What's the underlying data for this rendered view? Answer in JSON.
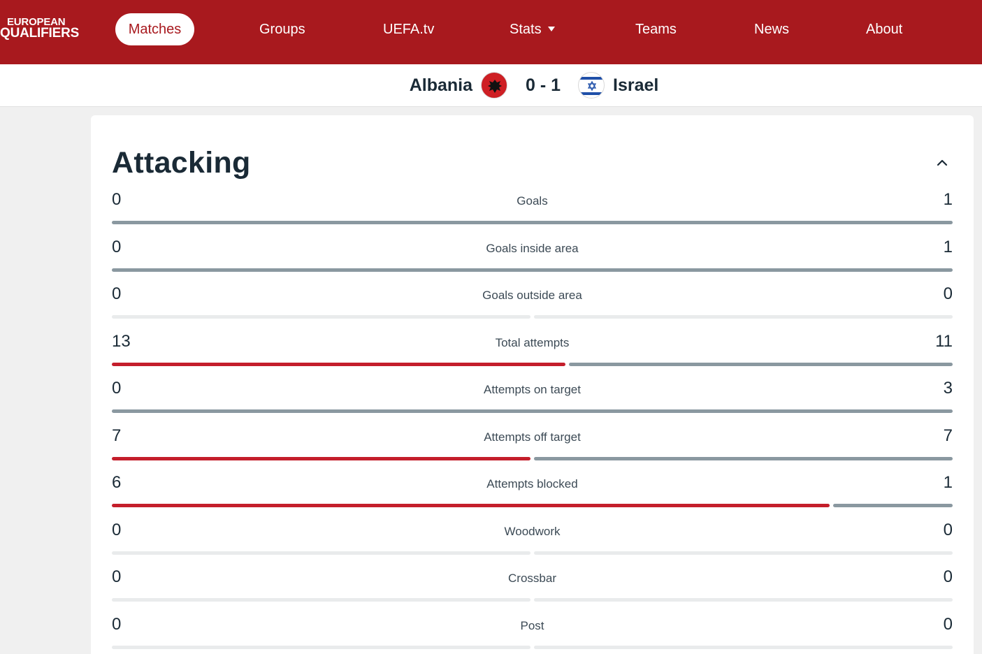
{
  "nav": {
    "logo_line1": "EUROPEAN",
    "logo_line2": "QUALIFIERS",
    "items": [
      {
        "label": "Matches",
        "active": true
      },
      {
        "label": "Groups"
      },
      {
        "label": "UEFA.tv"
      },
      {
        "label": "Stats",
        "has_dropdown": true
      },
      {
        "label": "Teams"
      },
      {
        "label": "News"
      },
      {
        "label": "About"
      }
    ]
  },
  "match": {
    "home_team": "Albania",
    "away_team": "Israel",
    "score": "0 - 1"
  },
  "section": {
    "title": "Attacking",
    "expanded": true
  },
  "colors": {
    "brand": "#a8191e",
    "home_bar": "#c41e2b",
    "away_bar": "#8a98a0",
    "empty_bar": "#e9ebec"
  },
  "stats": [
    {
      "label": "Goals",
      "home": "0",
      "away": "1"
    },
    {
      "label": "Goals inside area",
      "home": "0",
      "away": "1"
    },
    {
      "label": "Goals outside area",
      "home": "0",
      "away": "0"
    },
    {
      "label": "Total attempts",
      "home": "13",
      "away": "11"
    },
    {
      "label": "Attempts on target",
      "home": "0",
      "away": "3"
    },
    {
      "label": "Attempts off target",
      "home": "7",
      "away": "7"
    },
    {
      "label": "Attempts blocked",
      "home": "6",
      "away": "1"
    },
    {
      "label": "Woodwork",
      "home": "0",
      "away": "0"
    },
    {
      "label": "Crossbar",
      "home": "0",
      "away": "0"
    },
    {
      "label": "Post",
      "home": "0",
      "away": "0"
    }
  ]
}
